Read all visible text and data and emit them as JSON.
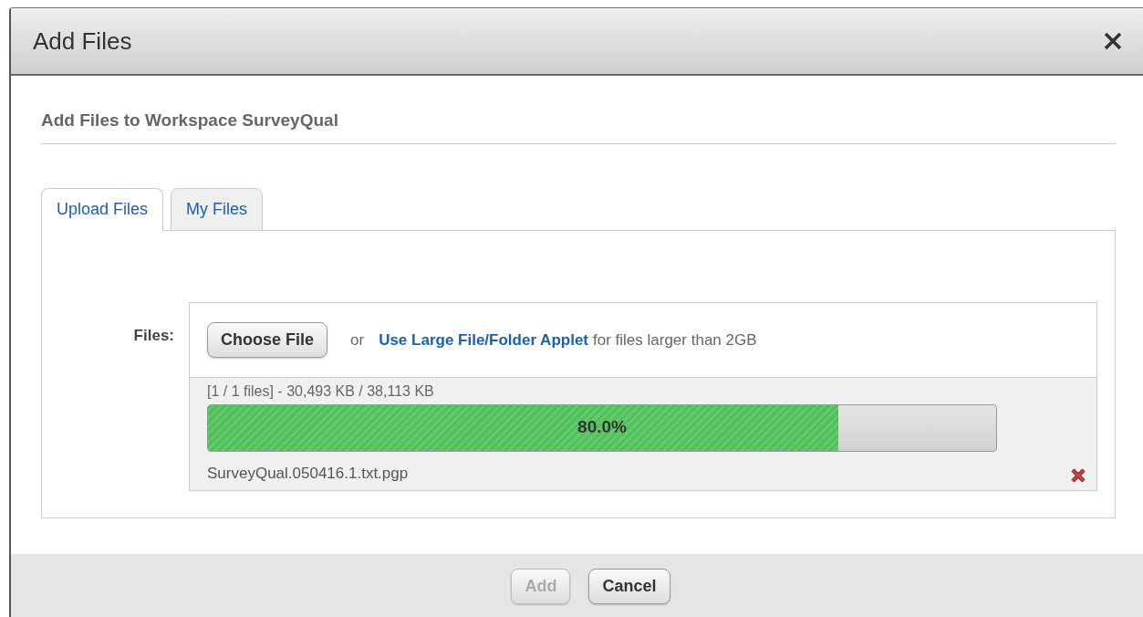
{
  "dialog": {
    "title": "Add Files",
    "heading": "Add Files to Workspace SurveyQual"
  },
  "tabs": [
    {
      "label": "Upload Files",
      "selected": true
    },
    {
      "label": "My Files",
      "selected": false
    }
  ],
  "upload": {
    "label": "Files:",
    "choose_button": "Choose File",
    "or_text": "or",
    "link": "Use Large File/Folder Applet",
    "link_hint": "for files larger than 2GB",
    "summary": "[1 / 1 files] - 30,493 KB / 38,113 KB",
    "progress": {
      "level": 0.8,
      "reading": "80.0%"
    },
    "file_name": "SurveyQual.050416.1.txt.pgp"
  },
  "buttons": [
    {
      "label": "Add",
      "disabled": true
    },
    {
      "label": "Cancel",
      "disabled": false
    }
  ]
}
